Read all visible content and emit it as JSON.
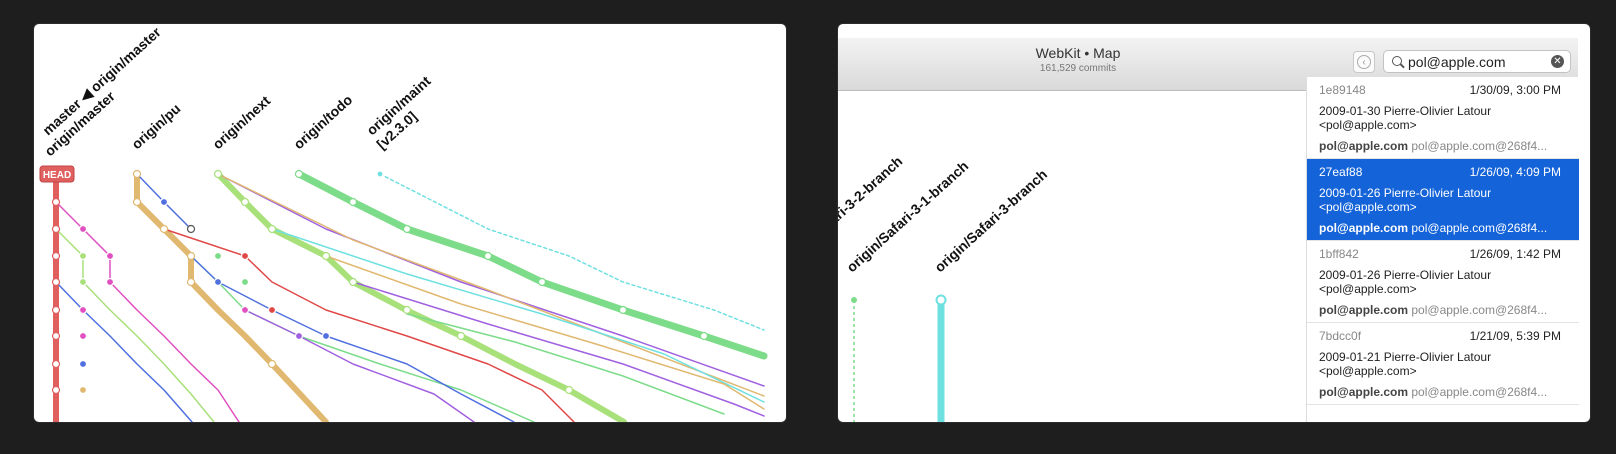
{
  "left_panel": {
    "branch_labels": [
      {
        "id": "master",
        "text": "master ◀ origin/master"
      },
      {
        "id": "origin-master",
        "text": "origin/master"
      },
      {
        "id": "pu",
        "text": "origin/pu"
      },
      {
        "id": "next",
        "text": "origin/next"
      },
      {
        "id": "todo",
        "text": "origin/todo"
      },
      {
        "id": "maint-1",
        "text": "origin/maint"
      },
      {
        "id": "maint-2",
        "text": "[v2.3.0]"
      }
    ],
    "head_badge": "HEAD"
  },
  "right_panel": {
    "window": {
      "title": "WebKit • Map",
      "subtitle": "161,529 commits"
    },
    "search": {
      "value": "pol@apple.com",
      "placeholder": "Search"
    },
    "branch_labels": [
      {
        "id": "safari-3-2",
        "text": "ari-3-2-branch"
      },
      {
        "id": "safari-3-1",
        "text": "origin/Safari-3-1-branch"
      },
      {
        "id": "safari-3",
        "text": "origin/Safari-3-branch"
      }
    ],
    "results": [
      {
        "sha": "1e89148",
        "date": "1/30/09, 3:00 PM",
        "message": "2009-01-30  Pierre-Olivier Latour <pol@apple.com>",
        "email_bold": "pol@apple.com",
        "email_rest": " pol@apple.com@268f4...",
        "selected": false
      },
      {
        "sha": "27eaf88",
        "date": "1/26/09, 4:09 PM",
        "message": "2009-01-26  Pierre-Olivier Latour <pol@apple.com>",
        "email_bold": "pol@apple.com",
        "email_rest": " pol@apple.com@268f4...",
        "selected": true
      },
      {
        "sha": "1bff842",
        "date": "1/26/09, 1:42 PM",
        "message": "2009-01-26  Pierre-Olivier Latour <pol@apple.com>",
        "email_bold": "pol@apple.com",
        "email_rest": " pol@apple.com@268f4...",
        "selected": false
      },
      {
        "sha": "7bdcc0f",
        "date": "1/21/09, 5:39 PM",
        "message": "2009-01-21  Pierre-Olivier Latour <pol@apple.com>",
        "email_bold": "pol@apple.com",
        "email_rest": " pol@apple.com@268f4...",
        "selected": false
      }
    ]
  },
  "colors": {
    "selection": "#1463d8",
    "head": "#e06060",
    "green": "#7ddc8a",
    "cyan": "#6fe0e0",
    "tan": "#e0b870",
    "lime": "#a8e07a",
    "purple": "#a060e0",
    "blue": "#5070e0",
    "pink": "#e050c0",
    "red": "#e04848"
  }
}
